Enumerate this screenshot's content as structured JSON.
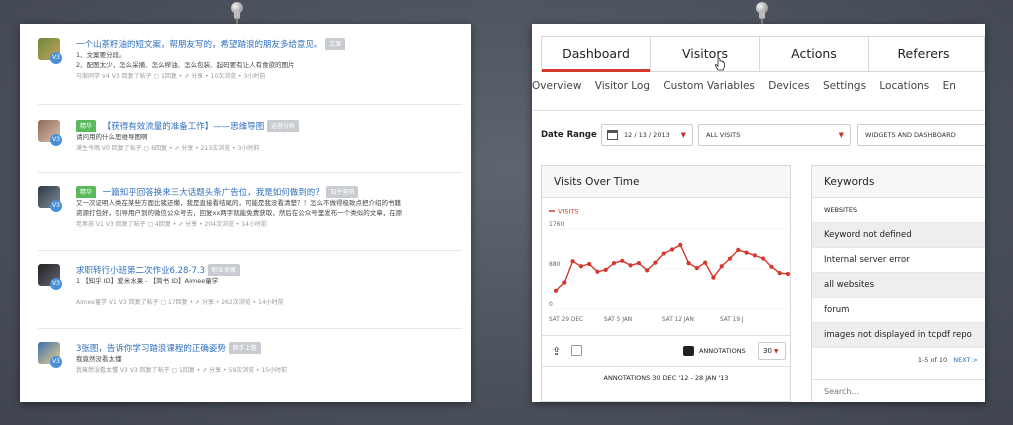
{
  "left_feed": {
    "items": [
      {
        "title": "一个山茶籽油的短文案，帮朋友写的，希望踏浪的朋友多给意见。",
        "tag": "",
        "trail_tag": "文案",
        "lines": [
          "1、文案要分段。",
          "2、配图太少，怎么采摘、怎么榨油、怎么包装、起码要有让人有食欲的图片"
        ],
        "meta": "马渐同学 V4 V3 回复了帖子  ▢ 1回复 • ⇗ 分享 • 10次浏览 • 3小时前"
      },
      {
        "title": "【获得有效流量的准备工作】——思维导图",
        "tag": "精华",
        "trail_tag": "运营分析",
        "lines": [
          "请问用的什么思维导图啊"
        ],
        "meta": "漠生今雨 V0 回复了帖子  ▢ 6回复 • ⇗ 分享 • 213次浏览 • 3小时前"
      },
      {
        "title": "一篇知乎回答换来三大话题头条广告位，我是如何做到的？",
        "tag": "精华",
        "trail_tag": "知乎营销",
        "lines": [
          "又一次证明人类在某些方面比猪还懒，我是直接看结尾的，可能是我没看清楚？！怎么不做得极致点把介绍的书籍",
          "资源打包好，引导用户到的微信公众号去，回复xx两字就能免费获取，然后在公众号里发布一个类似的文章，在原"
        ],
        "meta": "老男孩 V1 V3 回复了帖子  ▢ 4回复 • ⇗ 分享 • 204次浏览 • 14小时前"
      },
      {
        "title": "求职转行小班第二次作业6.28-7.3",
        "tag": "",
        "trail_tag": "职业发展",
        "lines": [
          "1 【知乎 ID】爱米水果 - 【简书 ID】Aimee童学"
        ],
        "meta": "Aimee童学 V1 V3 回复了帖子  ▢ 17回复 • ⇗ 分享 • 262次浏览 • 14小时前"
      },
      {
        "title": "3张图，告诉你学习踏浪课程的正确姿势",
        "tag": "",
        "trail_tag": "新手上路",
        "lines": [
          "我竟然没看太懂"
        ],
        "meta": "我竟然没看太懂 V3 V3 回复了帖子  ▢ 1回复 • ⇗ 分享 • 59次浏览 • 15小时前"
      }
    ]
  },
  "dashboard": {
    "tabs": [
      "Dashboard",
      "Visitors",
      "Actions",
      "Referers"
    ],
    "active_tab": "Dashboard",
    "subnav": [
      "Overview",
      "Visitor Log",
      "Custom Variables",
      "Devices",
      "Settings",
      "Locations",
      "En"
    ],
    "filters": {
      "date_range_label": "Date Range",
      "date_value": "12 / 13 / 2013",
      "visits_select": "ALL VISITS",
      "widgets_select": "WIDGETS AND DASHBOARD"
    },
    "visits_widget": {
      "title": "Visits Over Time",
      "annotations_button": "ANNOTATIONS",
      "per_page": "30",
      "footer": "ANNOTATIONS 30 DEC '12 - 28 JAN '13"
    },
    "keywords_widget": {
      "title": "Keywords",
      "column": "WEBSITES",
      "rows": [
        "Keyword not defined",
        "Internal server error",
        "all websites",
        "forum",
        "images not displayed in tcpdf repo"
      ],
      "pagination": "1-5 of 10",
      "next": "NEXT >",
      "search_placeholder": "Search..."
    }
  },
  "chart_data": {
    "type": "line",
    "title": "",
    "series": [
      {
        "name": "VISITS",
        "color": "#d4372c",
        "values": [
          400,
          580,
          1050,
          940,
          990,
          820,
          860,
          1010,
          1060,
          960,
          1010,
          850,
          1020,
          1220,
          1310,
          1410,
          1010,
          900,
          1020,
          690,
          940,
          1110,
          1300,
          1240,
          1180,
          1110,
          930,
          790,
          770
        ]
      }
    ],
    "x_tick_labels": [
      "SAT 29 DEC",
      "SAT 5 JAN",
      "SAT 12 JAN",
      "SAT 19 J"
    ],
    "y_tick_labels": [
      "1760",
      "880",
      "0"
    ],
    "ylim": [
      0,
      1760
    ],
    "grid": true
  },
  "colors": {
    "accent": "#d4372c",
    "link": "#2e6fbf",
    "tag_green": "#5cb85c",
    "background": "#4f5561"
  }
}
